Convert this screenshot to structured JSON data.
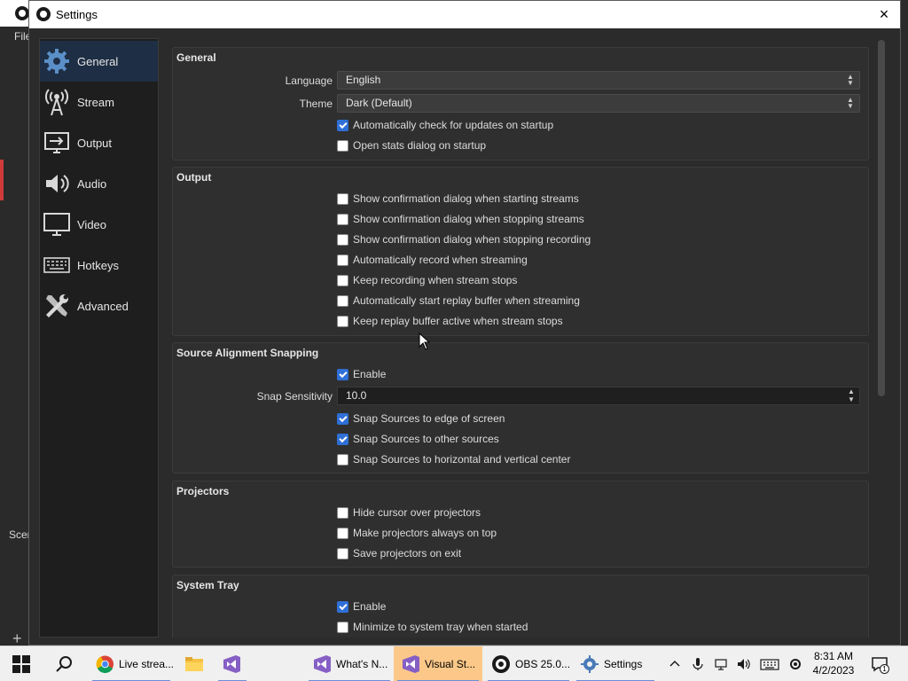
{
  "background": {
    "file_menu": "File",
    "scenes_label": "Scenes",
    "add_glyph": "+"
  },
  "window": {
    "title": "Settings",
    "close_glyph": "×"
  },
  "sidebar": {
    "items": [
      {
        "label": "General",
        "icon": "gear-icon",
        "active": true
      },
      {
        "label": "Stream",
        "icon": "broadcast-icon"
      },
      {
        "label": "Output",
        "icon": "output-icon"
      },
      {
        "label": "Audio",
        "icon": "speaker-icon"
      },
      {
        "label": "Video",
        "icon": "monitor-icon"
      },
      {
        "label": "Hotkeys",
        "icon": "keyboard-icon"
      },
      {
        "label": "Advanced",
        "icon": "tools-icon"
      }
    ]
  },
  "general": {
    "title": "General",
    "language_label": "Language",
    "language_value": "English",
    "theme_label": "Theme",
    "theme_value": "Dark (Default)",
    "checks": [
      {
        "label": "Automatically check for updates on startup",
        "checked": true
      },
      {
        "label": "Open stats dialog on startup",
        "checked": false
      }
    ]
  },
  "output": {
    "title": "Output",
    "checks": [
      {
        "label": "Show confirmation dialog when starting streams",
        "checked": false
      },
      {
        "label": "Show confirmation dialog when stopping streams",
        "checked": false
      },
      {
        "label": "Show confirmation dialog when stopping recording",
        "checked": false
      },
      {
        "label": "Automatically record when streaming",
        "checked": false
      },
      {
        "label": "Keep recording when stream stops",
        "checked": false
      },
      {
        "label": "Automatically start replay buffer when streaming",
        "checked": false
      },
      {
        "label": "Keep replay buffer active when stream stops",
        "checked": false
      }
    ]
  },
  "snapping": {
    "title": "Source Alignment Snapping",
    "enable": {
      "label": "Enable",
      "checked": true
    },
    "sensitivity_label": "Snap Sensitivity",
    "sensitivity_value": "10.0",
    "checks": [
      {
        "label": "Snap Sources to edge of screen",
        "checked": true
      },
      {
        "label": "Snap Sources to other sources",
        "checked": true
      },
      {
        "label": "Snap Sources to horizontal and vertical center",
        "checked": false
      }
    ]
  },
  "projectors": {
    "title": "Projectors",
    "checks": [
      {
        "label": "Hide cursor over projectors",
        "checked": false
      },
      {
        "label": "Make projectors always on top",
        "checked": false
      },
      {
        "label": "Save projectors on exit",
        "checked": false
      }
    ]
  },
  "system_tray": {
    "title": "System Tray",
    "checks": [
      {
        "label": "Enable",
        "checked": true
      },
      {
        "label": "Minimize to system tray when started",
        "checked": false
      }
    ]
  },
  "taskbar": {
    "items": [
      {
        "label": "Live strea...",
        "icon": "chrome-icon"
      },
      {
        "label": "",
        "icon": "file-explorer-icon"
      },
      {
        "label": "",
        "icon": "visual-studio-icon"
      },
      {
        "label": "What's N...",
        "icon": "visual-studio-icon"
      },
      {
        "label": "Visual St...",
        "icon": "visual-studio-icon",
        "active": true
      },
      {
        "label": "OBS 25.0...",
        "icon": "obs-icon"
      },
      {
        "label": "Settings",
        "icon": "obs-settings-icon"
      }
    ],
    "time": "8:31 AM",
    "date": "4/2/2023",
    "notification_count": "1"
  },
  "colors": {
    "accent": "#2f6fd6",
    "sidebar_active": "#1e2e44",
    "taskbar_active": "#fbc889"
  }
}
